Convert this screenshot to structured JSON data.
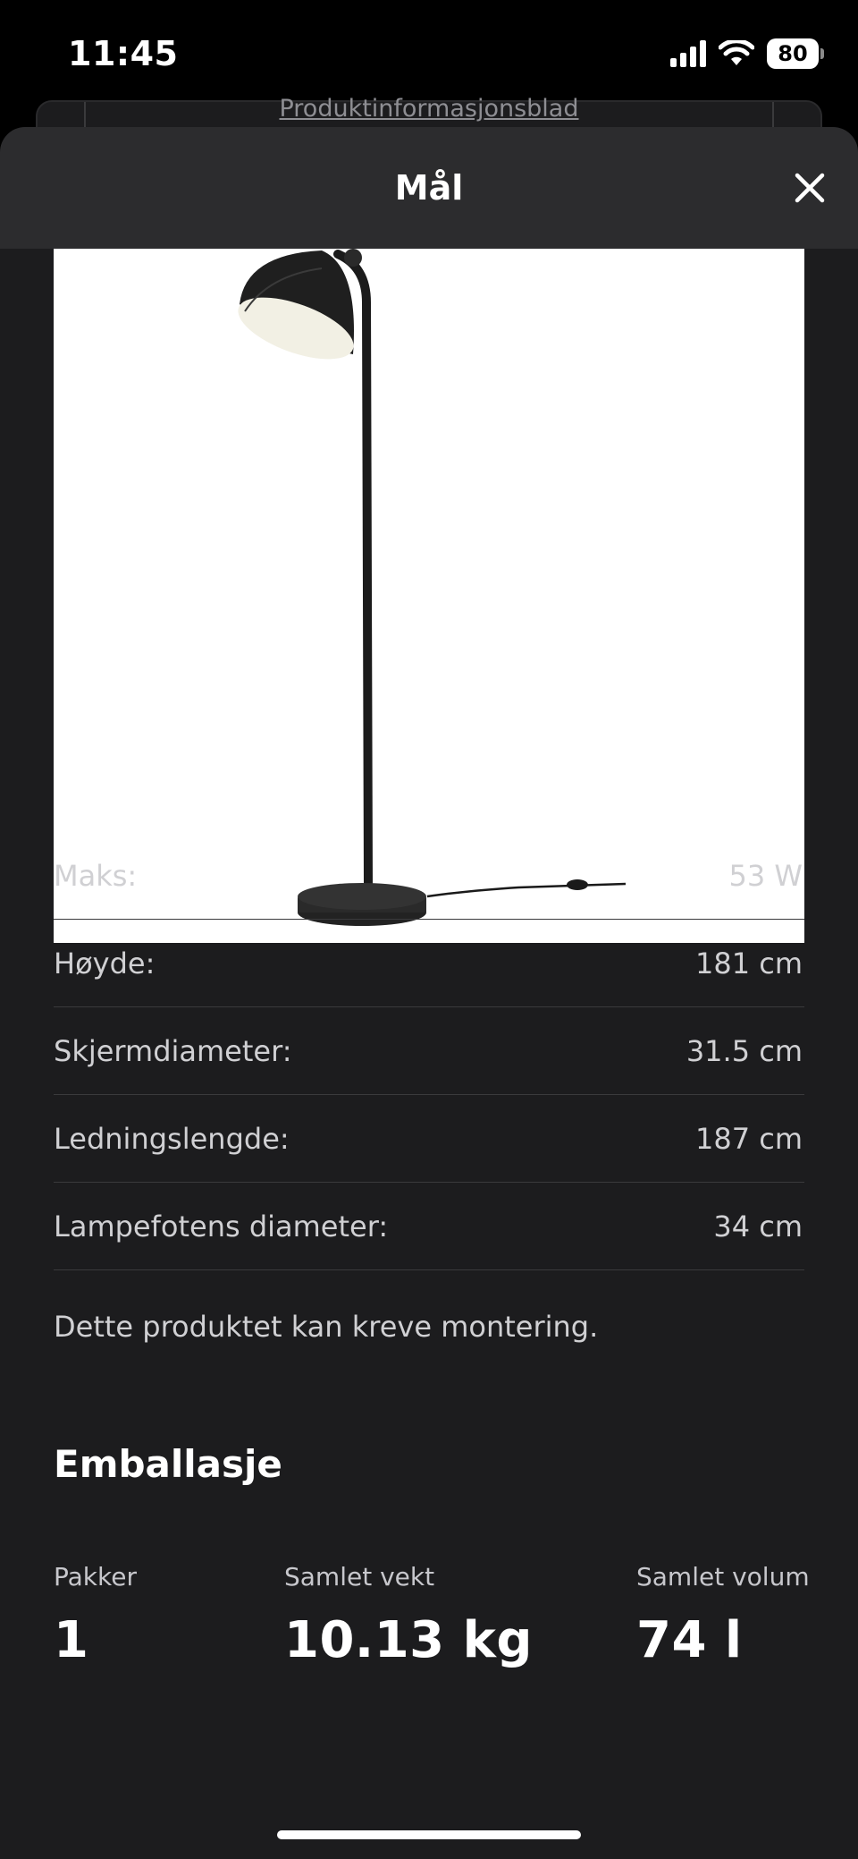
{
  "status_bar": {
    "time": "11:45",
    "battery": "80"
  },
  "background_page": {
    "link_text": "Produktinformasjonsblad"
  },
  "sheet": {
    "title": "Mål"
  },
  "icons": {
    "close": "close-icon",
    "signal": "cellular-signal-icon",
    "wifi": "wifi-icon",
    "battery": "battery-icon"
  },
  "specs": [
    {
      "label": "Maks:",
      "value": "53 W"
    },
    {
      "label": "Høyde:",
      "value": "181 cm"
    },
    {
      "label": "Skjermdiameter:",
      "value": "31.5 cm"
    },
    {
      "label": "Ledningslengde:",
      "value": "187 cm"
    },
    {
      "label": "Lampefotens diameter:",
      "value": "34 cm"
    }
  ],
  "assembly_note": "Dette produktet kan kreve montering.",
  "packaging": {
    "title": "Emballasje",
    "packages_label": "Pakker",
    "packages_value": "1",
    "weight_label": "Samlet vekt",
    "weight_value": "10.13 kg",
    "volume_label": "Samlet volum",
    "volume_value": "74 l"
  }
}
